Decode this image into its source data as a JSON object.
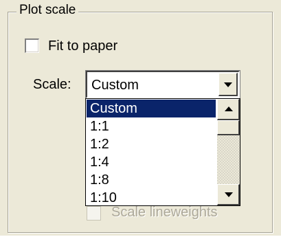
{
  "group": {
    "title": "Plot scale"
  },
  "fit_to_paper": {
    "label": "Fit to paper",
    "checked": false
  },
  "scale": {
    "label": "Scale:",
    "selected": "Custom",
    "options": [
      "Custom",
      "1:1",
      "1:2",
      "1:4",
      "1:8",
      "1:10"
    ]
  },
  "lineweights": {
    "label": "Scale lineweights",
    "checked": false,
    "enabled": false
  },
  "colors": {
    "panel_bg": "#ece9d8",
    "selection_bg": "#0a246a",
    "selection_text": "#ffffff",
    "disabled_text": "#aca899"
  },
  "icons": {
    "combo_arrow": "chevron-down-icon",
    "scroll_up": "scroll-up-icon",
    "scroll_down": "scroll-down-icon"
  }
}
